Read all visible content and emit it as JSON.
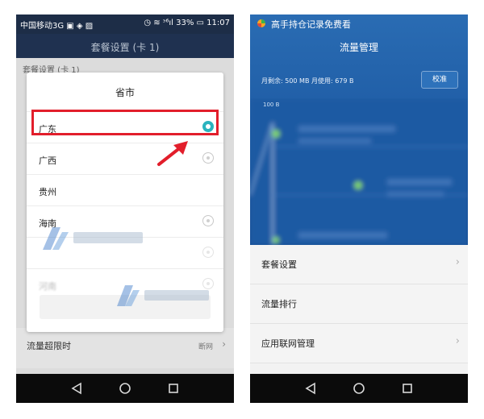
{
  "left": {
    "statusbar": {
      "carrier": "中国移动3G ▣ ◈ ▨",
      "right": "◷ ≋ ᵌ⁶ıl 33% ▭ 11:07"
    },
    "header": {
      "title": "套餐设置 (卡 1)"
    },
    "background": {
      "section": "套餐设置 (卡 1)",
      "row_label": "流量超限时",
      "row_value": "断网"
    },
    "dialog": {
      "title": "省市",
      "items": [
        {
          "name": "广东",
          "selected": true
        },
        {
          "name": "广西",
          "selected": false
        },
        {
          "name": "贵州",
          "selected": false
        },
        {
          "name": "海南",
          "selected": false
        },
        {
          "name": "",
          "selected": false
        },
        {
          "name": "河南",
          "selected": false
        }
      ]
    }
  },
  "right": {
    "appname": "高手持仓记录免费看",
    "title": "流量管理",
    "usage": "月剩余: 500 MB 月使用: 679 B",
    "calibrate": "校准",
    "chart_top_label": "100 B",
    "menu": [
      {
        "label": "套餐设置",
        "chevron": "›"
      },
      {
        "label": "流量排行",
        "chevron": ""
      },
      {
        "label": "应用联网管理",
        "chevron": "›"
      }
    ]
  },
  "colors": {
    "selected_radio": "#2ab3be",
    "highlight": "#e21e2b",
    "header_dark": "#1f3150",
    "traffic_blue": "#1f5da6"
  },
  "icons": {
    "back": "back-icon",
    "home": "home-icon",
    "recent": "recent-apps-icon"
  }
}
